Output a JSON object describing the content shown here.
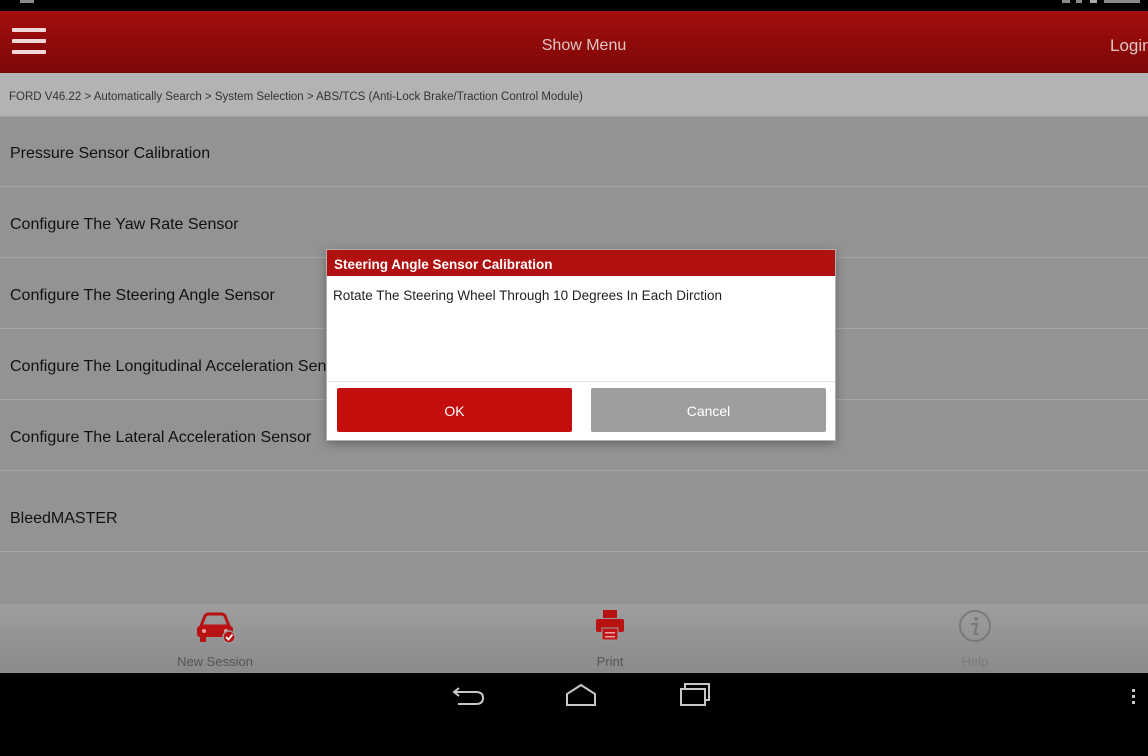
{
  "header": {
    "center_label": "Show Menu",
    "login_label": "Login"
  },
  "breadcrumb": {
    "text": "FORD V46.22 > Automatically Search > System Selection > ABS/TCS (Anti-Lock Brake/Traction Control Module)"
  },
  "list": {
    "items": [
      {
        "label": "Pressure Sensor Calibration"
      },
      {
        "label": "Configure The Yaw Rate Sensor"
      },
      {
        "label": "Configure The Steering Angle Sensor"
      },
      {
        "label": "Configure The Longitudinal Acceleration Sensor"
      },
      {
        "label": "Configure The Lateral Acceleration Sensor"
      },
      {
        "label": "BleedMASTER"
      }
    ]
  },
  "dialog": {
    "title": "Steering Angle Sensor Calibration",
    "message": "Rotate The Steering Wheel Through 10 Degrees In Each Dirction",
    "ok_label": "OK",
    "cancel_label": "Cancel"
  },
  "toolbar": {
    "new_session_label": "New Session",
    "print_label": "Print",
    "help_label": "Help"
  },
  "icons": {
    "menu": "hamburger-menu-icon",
    "new_session": "car-icon",
    "print": "printer-icon",
    "help": "info-icon",
    "nav_back": "back-arrow-icon",
    "nav_home": "home-icon",
    "nav_recents": "recent-apps-icon",
    "nav_overflow": "more-vertical-icon"
  },
  "colors": {
    "brand_red": "#a50d0d",
    "ok_button": "#c40d0d",
    "cancel_button": "#9e9e9e"
  }
}
